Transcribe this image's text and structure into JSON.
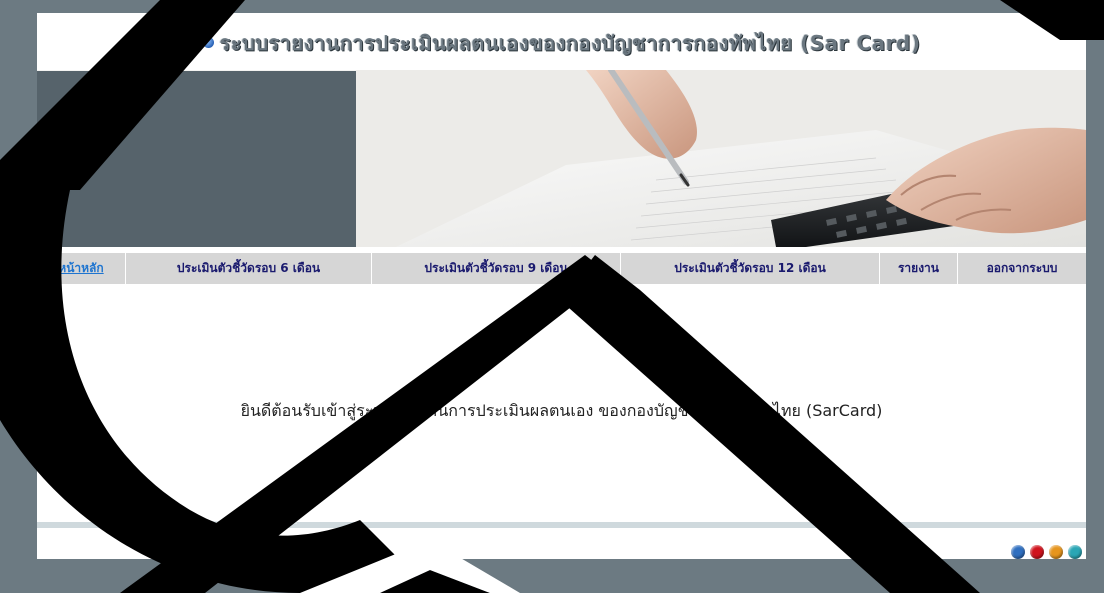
{
  "header": {
    "title": "ระบบรายงานการประเมินผลตนเองของกองบัญชาการกองทัพไทย (Sar Card)"
  },
  "nav": {
    "items": [
      {
        "label": "หน้าหลัก",
        "active": true
      },
      {
        "label": "ประเมินตัวชี้วัดรอบ 6 เดือน",
        "active": false
      },
      {
        "label": "ประเมินตัวชี้วัดรอบ 9 เดือน",
        "active": false
      },
      {
        "label": "ประเมินตัวชี้วัดรอบ 12 เดือน",
        "active": false
      },
      {
        "label": "รายงาน",
        "active": false
      },
      {
        "label": "ออกจากระบบ",
        "active": false
      }
    ]
  },
  "main": {
    "welcome": "ยินดีต้อนรับเข้าสู่ระบบรายงานการประเมินผลตนเอง ของกองบัญชาการกองทัพไทย (SarCard)"
  },
  "footer": {
    "dots": [
      {
        "color": "#2f6fc0",
        "icon": "blue-dot-icon"
      },
      {
        "color": "#d0131e",
        "icon": "red-dot-icon"
      },
      {
        "color": "#e6951e",
        "icon": "orange-dot-icon"
      },
      {
        "color": "#2aa6b5",
        "icon": "teal-dot-icon"
      }
    ]
  },
  "colors": {
    "frame_bg": "#6c7a82",
    "hero_block": "#56636b",
    "nav_bg": "#d6d6d6",
    "nav_text": "#1a1a6e",
    "nav_active": "#1f75d0"
  }
}
